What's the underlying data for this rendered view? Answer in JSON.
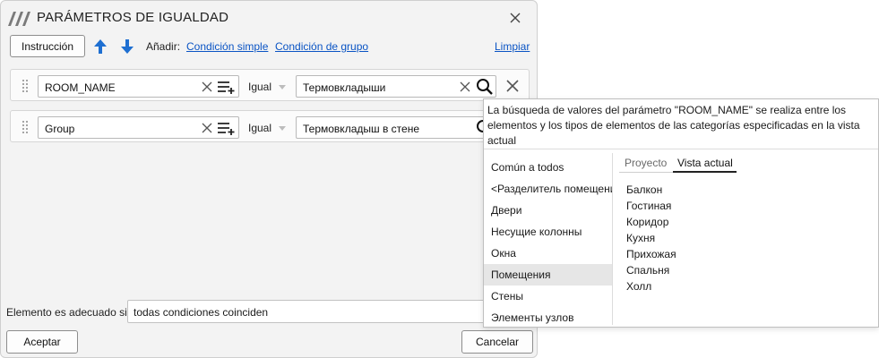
{
  "dialog": {
    "title": "PARÁMETROS DE IGUALDAD",
    "toolbar": {
      "instruction_label": "Instrucción",
      "add_label": "Añadir:",
      "simple_condition_link": "Condición simple",
      "group_condition_link": "Condición de grupo",
      "clear_link": "Limpiar"
    },
    "conditions": [
      {
        "parameter": "ROOM_NAME",
        "operator": "Igual",
        "value": "Термовкладыши"
      },
      {
        "parameter": "Group",
        "operator": "Igual",
        "value": "Термовкладыш в стене"
      }
    ],
    "match_label": "Elemento es adecuado si",
    "match_value": "todas condiciones coinciden",
    "ok_label": "Aceptar",
    "cancel_label": "Cancelar",
    "accent_color": "#1e6fd1"
  },
  "popup": {
    "message": "La búsqueda de valores del parámetro \"ROOM_NAME\" se realiza entre los elementos y los tipos de elementos de las categorías especificadas en la vista actual",
    "categories": [
      "Común a todos",
      "<Разделитель помещений>",
      "Двери",
      "Несущие колонны",
      "Окна",
      "Помещения",
      "Стены",
      "Элементы узлов"
    ],
    "selected_category": "Помещения",
    "tabs": [
      "Proyecto",
      "Vista actual"
    ],
    "active_tab": "Vista actual",
    "values": [
      "Балкон",
      "Гостиная",
      "Коридор",
      "Кухня",
      "Прихожая",
      "Спальня",
      "Холл"
    ]
  }
}
